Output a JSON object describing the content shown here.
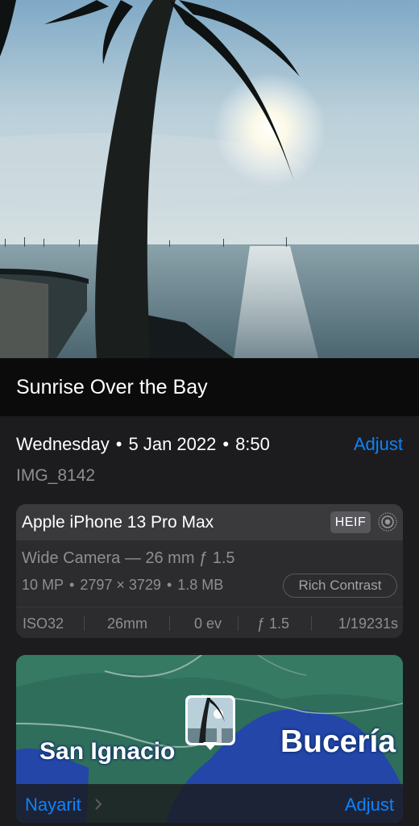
{
  "caption": "Sunrise Over the Bay",
  "info": {
    "day": "Wednesday",
    "date": "5 Jan 2022",
    "time": "8:50",
    "separator": "•",
    "adjust_label": "Adjust",
    "filename": "IMG_8142"
  },
  "camera": {
    "device": "Apple iPhone 13 Pro Max",
    "format_badge": "HEIF",
    "live_icon": "live-photo-icon",
    "lens": "Wide Camera — 26 mm ƒ 1.5",
    "megapixels": "10 MP",
    "resolution": "2797 × 3729",
    "file_size": "1.8 MB",
    "photographic_style": "Rich Contrast",
    "exif": [
      "ISO32",
      "26mm",
      "0 ev",
      "ƒ 1.5",
      "1/19231s"
    ]
  },
  "map": {
    "labels": [
      "San Ignacio",
      "Bucería"
    ],
    "region": "Nayarit",
    "adjust_label": "Adjust"
  },
  "colors": {
    "accent": "#0a84ff",
    "panel": "#1c1c1e",
    "card": "#2c2c2e"
  }
}
